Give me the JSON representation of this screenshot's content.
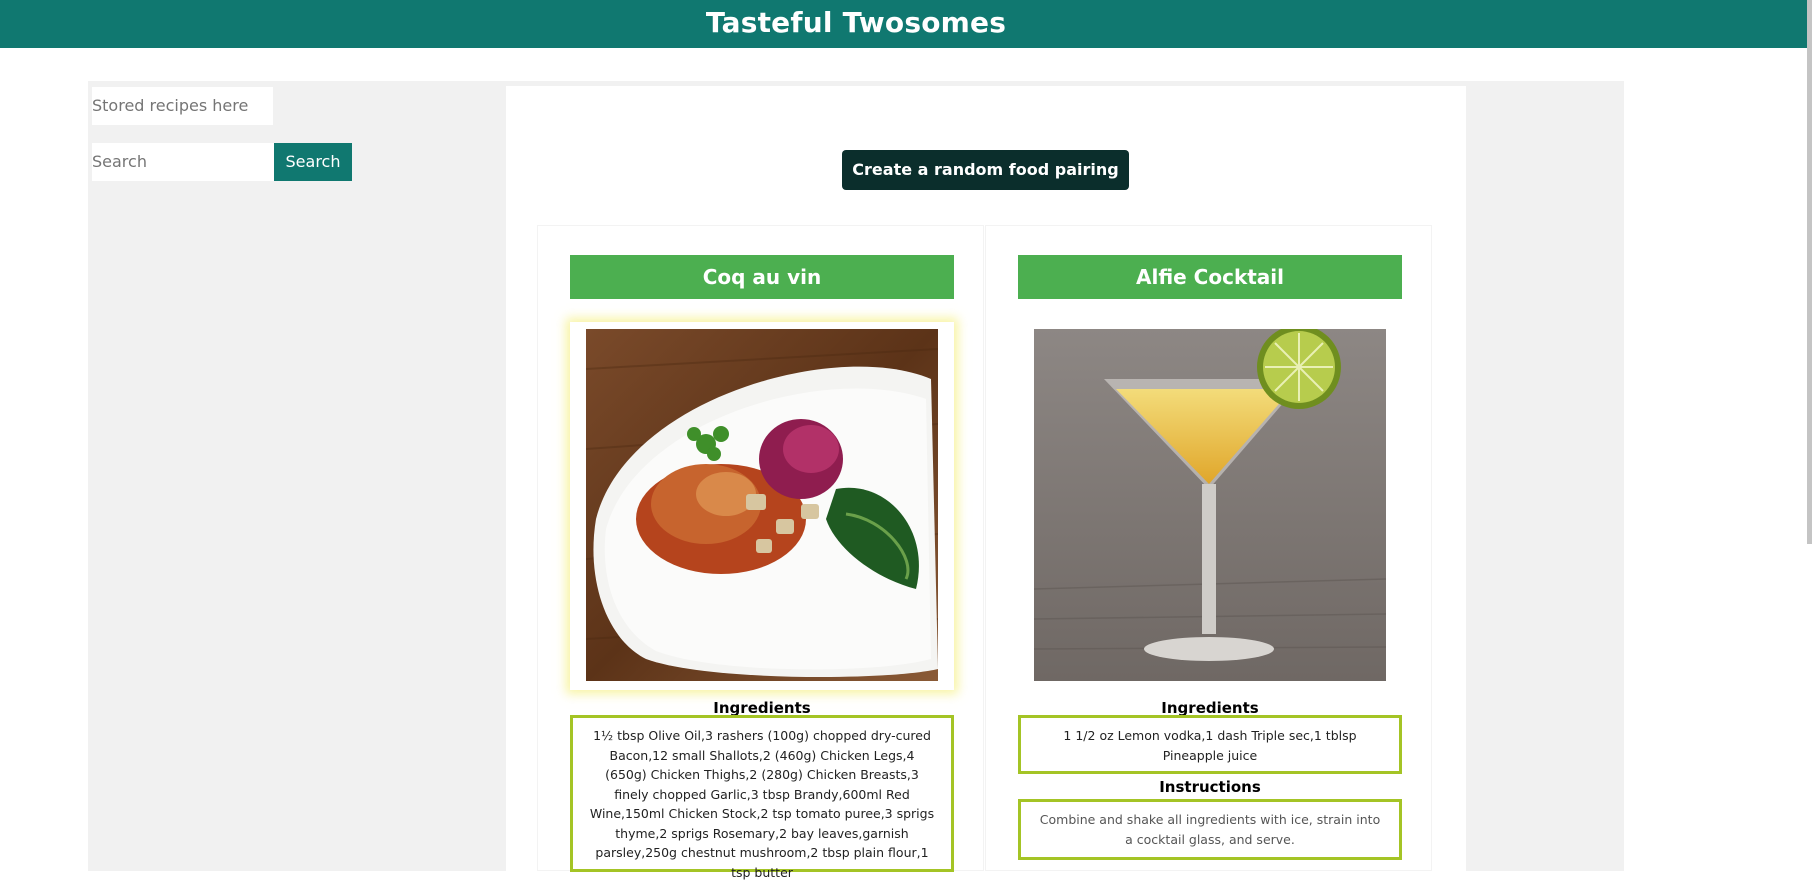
{
  "header": {
    "title": "Tasteful Twosomes"
  },
  "sidebar": {
    "stored_placeholder": "Stored recipes here",
    "search_placeholder": "Search",
    "search_button": "Search"
  },
  "main": {
    "random_button": "Create a random food pairing"
  },
  "food": {
    "title": "Coq au vin",
    "image_icon": "coq-au-vin-photo",
    "ingredients_label": "Ingredients",
    "ingredients": "1½ tbsp Olive Oil,3 rashers (100g) chopped dry-cured Bacon,12 small Shallots,2 (460g) Chicken Legs,4 (650g) Chicken Thighs,2 (280g) Chicken Breasts,3 finely chopped Garlic,3 tbsp Brandy,600ml Red Wine,150ml Chicken Stock,2 tsp tomato puree,3 sprigs thyme,2 sprigs Rosemary,2 bay leaves,garnish parsley,250g chestnut mushroom,2 tbsp plain flour,1 tsp butter"
  },
  "drink": {
    "title": "Alfie Cocktail",
    "image_icon": "alfie-cocktail-photo",
    "ingredients_label": "Ingredients",
    "ingredients": "1 1/2 oz Lemon vodka,1 dash Triple sec,1 tblsp Pineapple juice",
    "instructions_label": "Instructions",
    "instructions": "Combine and shake all ingredients with ice, strain into a cocktail glass, and serve."
  },
  "colors": {
    "header_bg": "#107870",
    "button_teal": "#107870",
    "random_button_bg": "#0b2e2c",
    "card_title_bg": "#4caf50",
    "text_box_border": "#a4c425"
  }
}
